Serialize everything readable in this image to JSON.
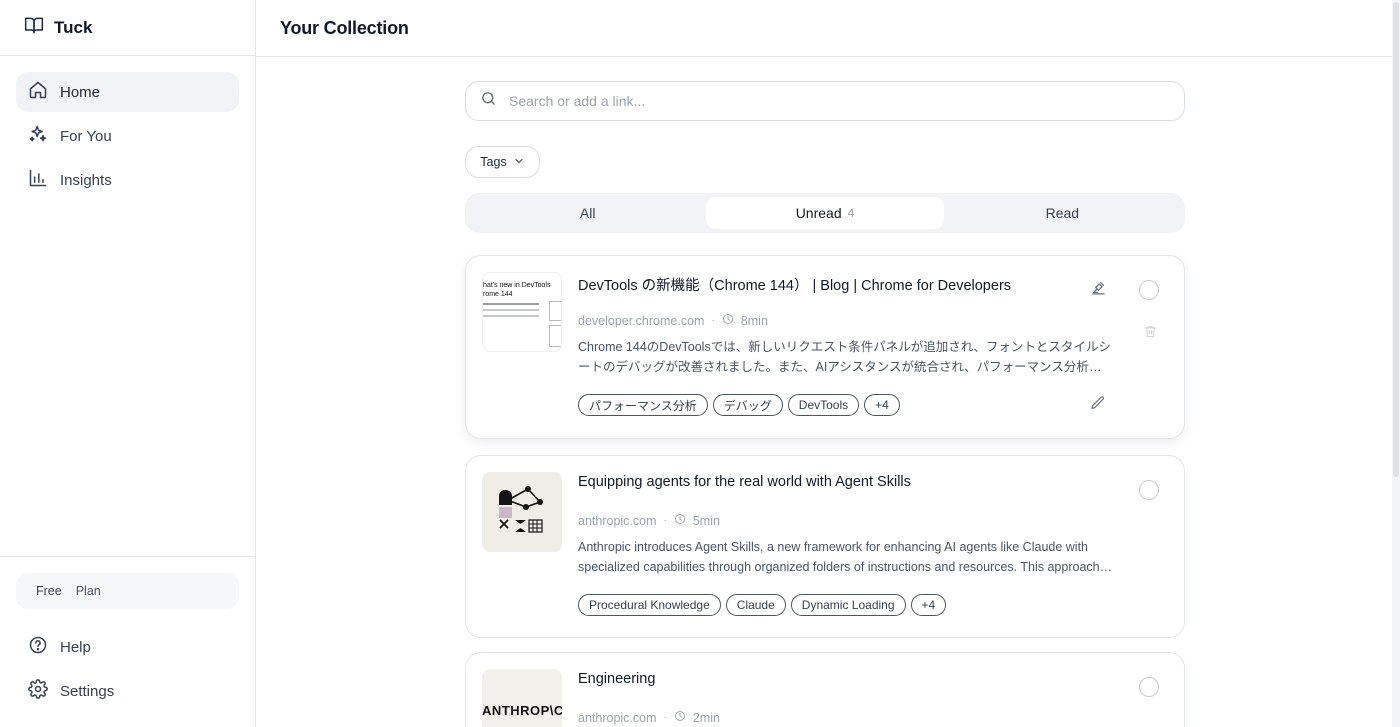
{
  "brand": {
    "name": "Tuck"
  },
  "sidebar": {
    "items": [
      {
        "label": "Home",
        "icon": "home-icon",
        "active": true
      },
      {
        "label": "For You",
        "icon": "sparkles-icon",
        "active": false
      },
      {
        "label": "Insights",
        "icon": "bar-chart-icon",
        "active": false
      }
    ],
    "plan": {
      "tier": "Free",
      "word": "Plan"
    },
    "bottom": [
      {
        "label": "Help",
        "icon": "help-circle-icon"
      },
      {
        "label": "Settings",
        "icon": "gear-icon"
      }
    ]
  },
  "header": {
    "title": "Your Collection"
  },
  "search": {
    "placeholder": "Search or add a link..."
  },
  "filters": {
    "tags_label": "Tags"
  },
  "tabs": [
    {
      "label": "All",
      "count": ""
    },
    {
      "label": "Unread",
      "count": "4"
    },
    {
      "label": "Read",
      "count": ""
    }
  ],
  "cards": [
    {
      "title": "DevTools の新機能（Chrome 144） | Blog | Chrome for Developers",
      "domain": "developer.chrome.com",
      "read_time": "8min",
      "description": "Chrome 144のDevToolsでは、新しいリクエスト条件パネルが追加され、フォントとスタイルシートのデバッグが改善されました。また、AIアシスタンスが統合され、パフォーマンス分析やビジュアルな操作が強化されています。",
      "tags": [
        "パフォーマンス分析",
        "デバッグ",
        "DevTools",
        "+4"
      ],
      "thumb_lines": [
        "hat's new in DevTools",
        "rome 144"
      ]
    },
    {
      "title": "Equipping agents for the real world with Agent Skills",
      "domain": "anthropic.com",
      "read_time": "5min",
      "description": "Anthropic introduces Agent Skills, a new framework for enhancing AI agents like Claude with specialized capabilities through organized folders of instructions and resources. This approach allows agents to load skills dynamically.",
      "tags": [
        "Procedural Knowledge",
        "Claude",
        "Dynamic Loading",
        "+4"
      ]
    },
    {
      "title": "Engineering",
      "domain": "anthropic.com",
      "read_time": "2min",
      "thumb_text": "ANTHROP\\C"
    }
  ],
  "colors": {
    "accent_bg": "#f1f3f6",
    "border": "#e2e5ea",
    "text": "#111827"
  }
}
